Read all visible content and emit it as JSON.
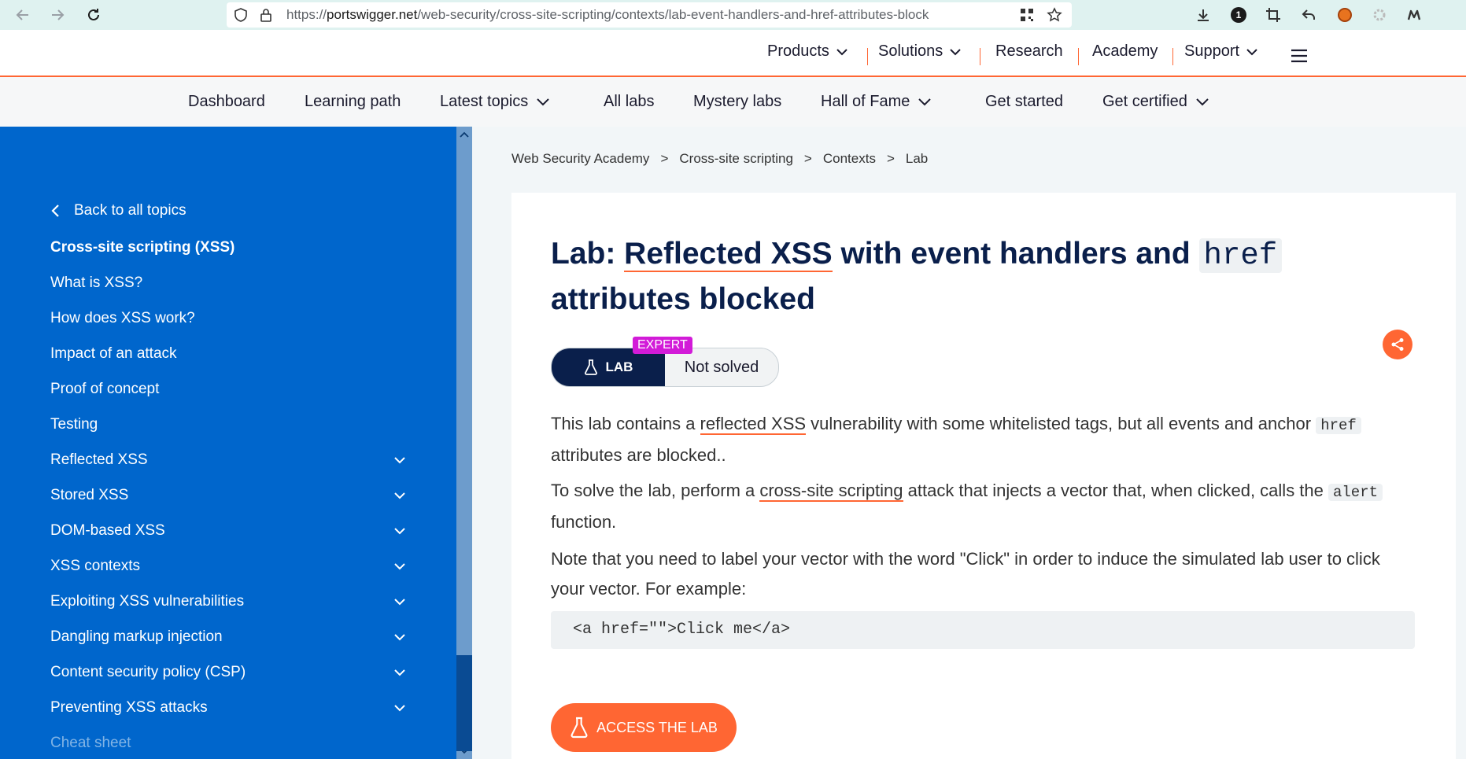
{
  "browser": {
    "url_scheme": "https://",
    "url_host": "portswigger.net",
    "url_path": "/web-security/cross-site-scripting/contexts/lab-event-handlers-and-href-attributes-block",
    "extension_badge": "1"
  },
  "top_nav": {
    "products": "Products",
    "solutions": "Solutions",
    "research": "Research",
    "academy": "Academy",
    "support": "Support"
  },
  "sub_nav": {
    "dashboard": "Dashboard",
    "learning_path": "Learning path",
    "latest_topics": "Latest topics",
    "all_labs": "All labs",
    "mystery_labs": "Mystery labs",
    "hall_of_fame": "Hall of Fame",
    "get_started": "Get started",
    "get_certified": "Get certified"
  },
  "sidebar": {
    "back": "Back to all topics",
    "heading": "Cross-site scripting (XSS)",
    "items": [
      {
        "label": "What is XSS?"
      },
      {
        "label": "How does XSS work?"
      },
      {
        "label": "Impact of an attack"
      },
      {
        "label": "Proof of concept"
      },
      {
        "label": "Testing"
      },
      {
        "label": "Reflected XSS"
      },
      {
        "label": "Stored XSS"
      },
      {
        "label": "DOM-based XSS"
      },
      {
        "label": "XSS contexts"
      },
      {
        "label": "Exploiting XSS vulnerabilities"
      },
      {
        "label": "Dangling markup injection"
      },
      {
        "label": "Content security policy (CSP)"
      },
      {
        "label": "Preventing XSS attacks"
      },
      {
        "label": "Cheat sheet"
      }
    ]
  },
  "breadcrumb": {
    "items": [
      "Web Security Academy",
      "Cross-site scripting",
      "Contexts",
      "Lab"
    ],
    "separator": ">"
  },
  "lab": {
    "title_prefix": "Lab: ",
    "title_link": "Reflected XSS",
    "title_mid": " with event handlers and ",
    "title_code": "href",
    "title_end": "attributes blocked",
    "badge_label": "LAB",
    "level": "EXPERT",
    "status": "Not solved",
    "p1_a": "This lab contains a ",
    "p1_link": "reflected XSS",
    "p1_b": " vulnerability with some whitelisted tags, but all events and anchor ",
    "p1_code": "href",
    "p1_c": " attributes are blocked..",
    "p2_a": "To solve the lab, perform a ",
    "p2_link": "cross-site scripting",
    "p2_b": " attack that injects a vector that, when clicked, calls the ",
    "p2_code": "alert",
    "p2_c": " function.",
    "p3": "Note that you need to label your vector with the word \"Click\" in order to induce the simulated lab user to click your vector. For example:",
    "code_example": "<a href=\"\">Click me</a>",
    "access_button": "ACCESS THE LAB"
  },
  "colors": {
    "brand_orange": "#ff6633",
    "sidebar_blue": "#0066cc",
    "navy": "#0a1f4b",
    "expert_magenta": "#d21bd8"
  }
}
